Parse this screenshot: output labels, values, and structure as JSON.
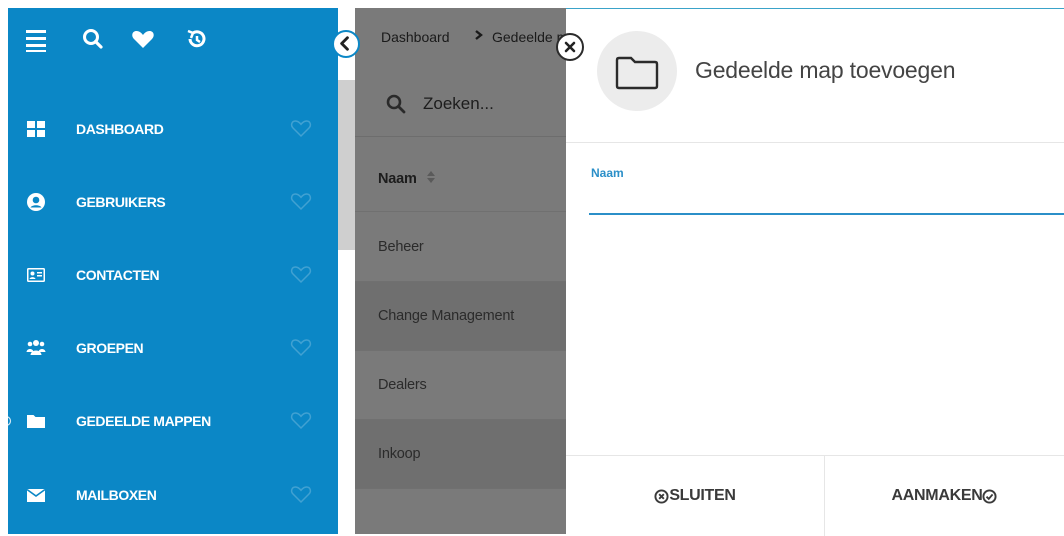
{
  "sidebar": {
    "top_icons": [
      "menu-icon",
      "search-icon",
      "heart-icon",
      "history-icon"
    ],
    "items": [
      {
        "label": "DASHBOARD",
        "icon": "grid-icon"
      },
      {
        "label": "GEBRUIKERS",
        "icon": "user-circle-icon"
      },
      {
        "label": "CONTACTEN",
        "icon": "contact-card-icon"
      },
      {
        "label": "GROEPEN",
        "icon": "group-icon"
      },
      {
        "label": "GEDEELDE MAPPEN",
        "icon": "folder-icon"
      },
      {
        "label": "MAILBOXEN",
        "icon": "envelope-icon"
      }
    ]
  },
  "breadcrumb": {
    "home": "Dashboard",
    "current": "Gedeelde mappen"
  },
  "search": {
    "placeholder": "Zoeken..."
  },
  "list": {
    "column_header": "Naam",
    "rows": [
      "Beheer",
      "Change Management",
      "Dealers",
      "Inkoop"
    ]
  },
  "dialog": {
    "title": "Gedeelde map toevoegen",
    "field_label": "Naam",
    "field_value": "",
    "cancel_label": "SLUITEN",
    "confirm_label": "AANMAKEN"
  },
  "colors": {
    "sidebar": "#0b87c6",
    "accent": "#2b8fc8",
    "overlay": "#7a7a7a"
  }
}
